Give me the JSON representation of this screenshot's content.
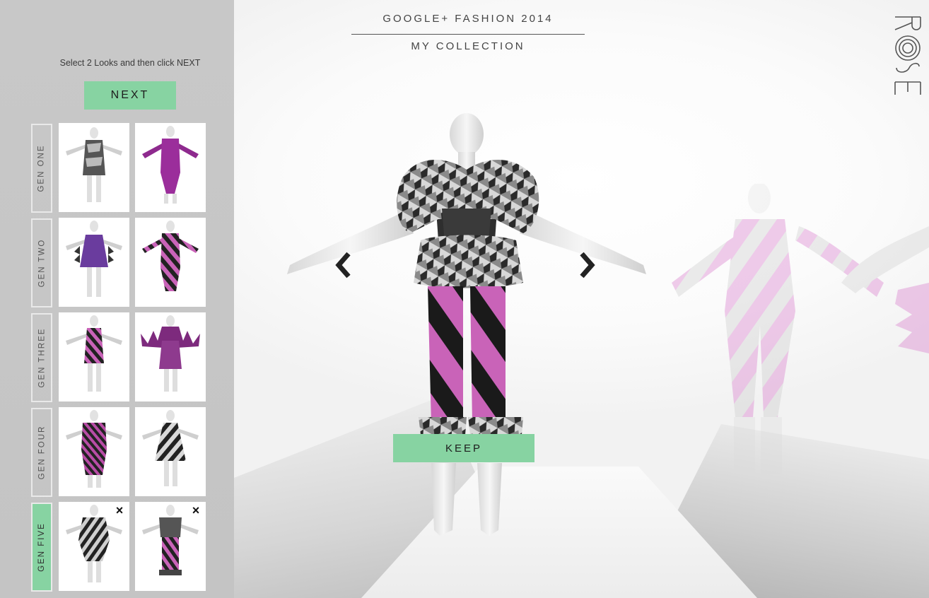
{
  "header": {
    "title": "GOOGLE+ FASHION 2014",
    "subtitle": "MY COLLECTION",
    "brand": "ROSE"
  },
  "sidebar": {
    "instruction": "Select 2 Looks and then click NEXT",
    "next_label": "NEXT",
    "generations": [
      {
        "label": "GEN ONE",
        "active": false
      },
      {
        "label": "GEN TWO",
        "active": false
      },
      {
        "label": "GEN THREE",
        "active": false
      },
      {
        "label": "GEN FOUR",
        "active": false
      },
      {
        "label": "GEN FIVE",
        "active": true
      }
    ],
    "remove_icon": "×"
  },
  "stage": {
    "keep_label": "KEEP",
    "prev_icon": "chevron-left-icon",
    "next_icon": "chevron-right-icon"
  },
  "colors": {
    "accent_green": "#87d3a2",
    "pink": "#c963b8",
    "purple": "#8e2a8e",
    "sidebar_bg": "#c6c6c6"
  }
}
